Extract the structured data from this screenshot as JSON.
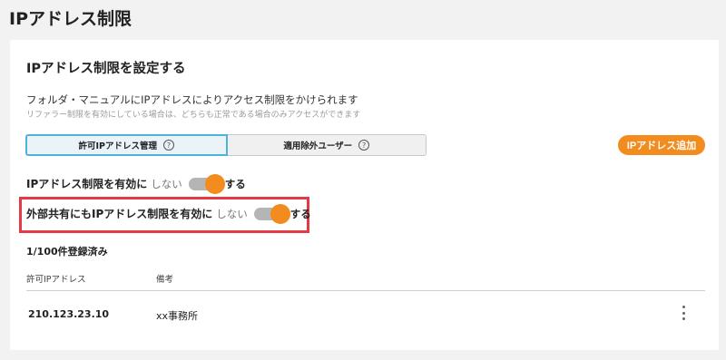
{
  "page": {
    "title": "IPアドレス制限"
  },
  "card": {
    "title": "IPアドレス制限を設定する",
    "description": "フォルダ・マニュアルにIPアドレスによりアクセス制限をかけられます",
    "subdescription": "リファラー制限を有効にしている場合は、どちらも正常である場合のみアクセスができます"
  },
  "tabs": [
    {
      "label": "許可IPアドレス管理",
      "active": true,
      "help_icon": "?"
    },
    {
      "label": "適用除外ユーザー",
      "active": false,
      "help_icon": "?"
    }
  ],
  "add_button": {
    "label": "IPアドレス追加"
  },
  "toggles": [
    {
      "label": "IPアドレス制限を有効に",
      "off_label": "しない",
      "on_label": "する",
      "state": "on"
    },
    {
      "label": "外部共有にもIPアドレス制限を有効に",
      "off_label": "しない",
      "on_label": "する",
      "state": "on"
    }
  ],
  "count_text": "1/100件登録済み",
  "table": {
    "headers": {
      "ip": "許可IPアドレス",
      "note": "備考"
    },
    "rows": [
      {
        "ip": "210.123.23.10",
        "note": "xx事務所"
      }
    ]
  },
  "colors": {
    "accent": "#f28c1e",
    "tab_border": "#4fb3d9",
    "highlight": "#e53946"
  }
}
